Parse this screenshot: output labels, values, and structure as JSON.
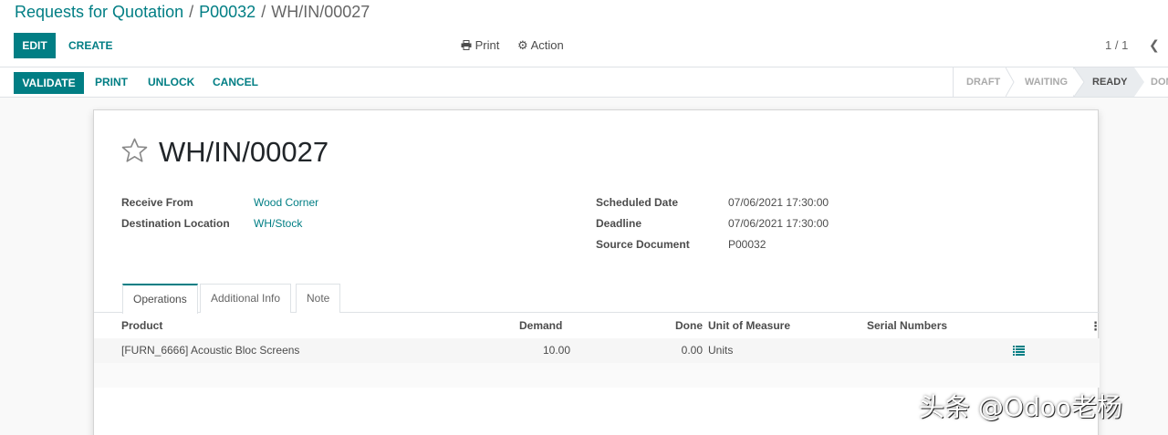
{
  "breadcrumb": {
    "items": [
      "Requests for Quotation",
      "P00032"
    ],
    "current": "WH/IN/00027",
    "separator": "/"
  },
  "toolbar": {
    "edit_label": "EDIT",
    "create_label": "CREATE",
    "print_label": "Print",
    "action_label": "Action",
    "pager": "1 / 1"
  },
  "statusbar": {
    "validate_label": "VALIDATE",
    "print_label": "PRINT",
    "unlock_label": "UNLOCK",
    "cancel_label": "CANCEL",
    "stages": [
      "DRAFT",
      "WAITING",
      "READY",
      "DONE"
    ],
    "active_stage": "READY"
  },
  "record": {
    "title": "WH/IN/00027",
    "fields_left": [
      {
        "label": "Receive From",
        "value": "Wood Corner"
      },
      {
        "label": "Destination Location",
        "value": "WH/Stock"
      }
    ],
    "fields_right": [
      {
        "label": "Scheduled Date",
        "value": "07/06/2021 17:30:00"
      },
      {
        "label": "Deadline",
        "value": "07/06/2021 17:30:00"
      },
      {
        "label": "Source Document",
        "value": "P00032"
      }
    ]
  },
  "tabs": [
    "Operations",
    "Additional Info",
    "Note"
  ],
  "table": {
    "headers": [
      "Product",
      "Demand",
      "Done",
      "Unit of Measure",
      "Serial Numbers"
    ],
    "rows": [
      {
        "product": "[FURN_6666] Acoustic Bloc Screens",
        "demand": "10.00",
        "done": "0.00",
        "uom": "Units"
      }
    ]
  },
  "watermark": "头条 @Odoo老杨",
  "colors": {
    "accent": "#017e84",
    "text": "#4c4c4c"
  }
}
